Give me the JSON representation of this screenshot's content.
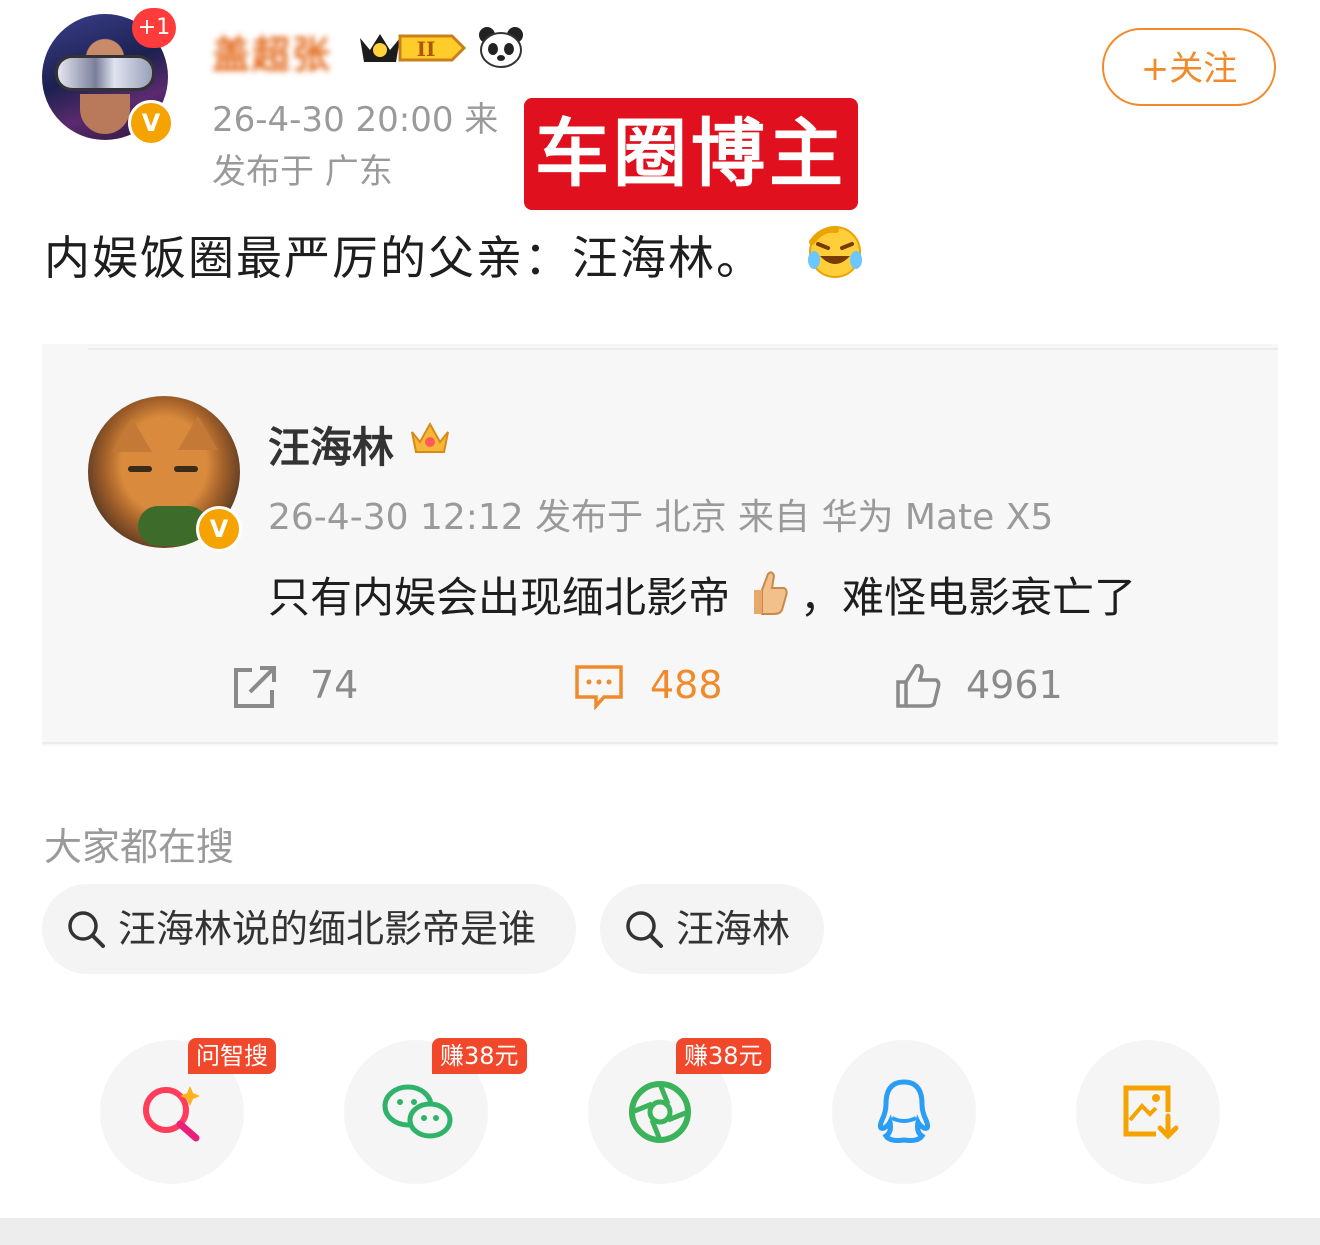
{
  "header": {
    "plus_badge": "+1",
    "username": "盖超张",
    "level_badge": "II",
    "timestamp_line": "26-4-30 20:00  来",
    "location_line": "发布于 广东",
    "follow_label": "+关注",
    "overlay_stamp": "车圈博主"
  },
  "post": {
    "text": "内娱饭圈最严厉的父亲：汪海林。"
  },
  "quoted": {
    "author": "汪海林",
    "meta": "26-4-30 12:12 发布于 北京  来自 华为 Mate X5",
    "text_part1": "只有内娱会出现缅北影帝",
    "text_part2": "，难怪电影衰亡了",
    "stats": {
      "reposts": "74",
      "comments": "488",
      "likes": "4961"
    }
  },
  "search": {
    "title": "大家都在搜",
    "chips": [
      "汪海林说的缅北影帝是谁",
      "汪海林"
    ]
  },
  "share_bar": {
    "items": [
      {
        "tag": "问智搜",
        "icon": "ai-search-icon"
      },
      {
        "tag": "赚38元",
        "icon": "wechat-icon"
      },
      {
        "tag": "赚38元",
        "icon": "moments-icon"
      },
      {
        "tag": "",
        "icon": "qq-icon"
      },
      {
        "tag": "",
        "icon": "save-image-icon"
      }
    ]
  },
  "colors": {
    "accent": "#f08a2a",
    "stamp": "#e0101e",
    "meta": "#9a9a9a",
    "tag": "#f1472b"
  }
}
